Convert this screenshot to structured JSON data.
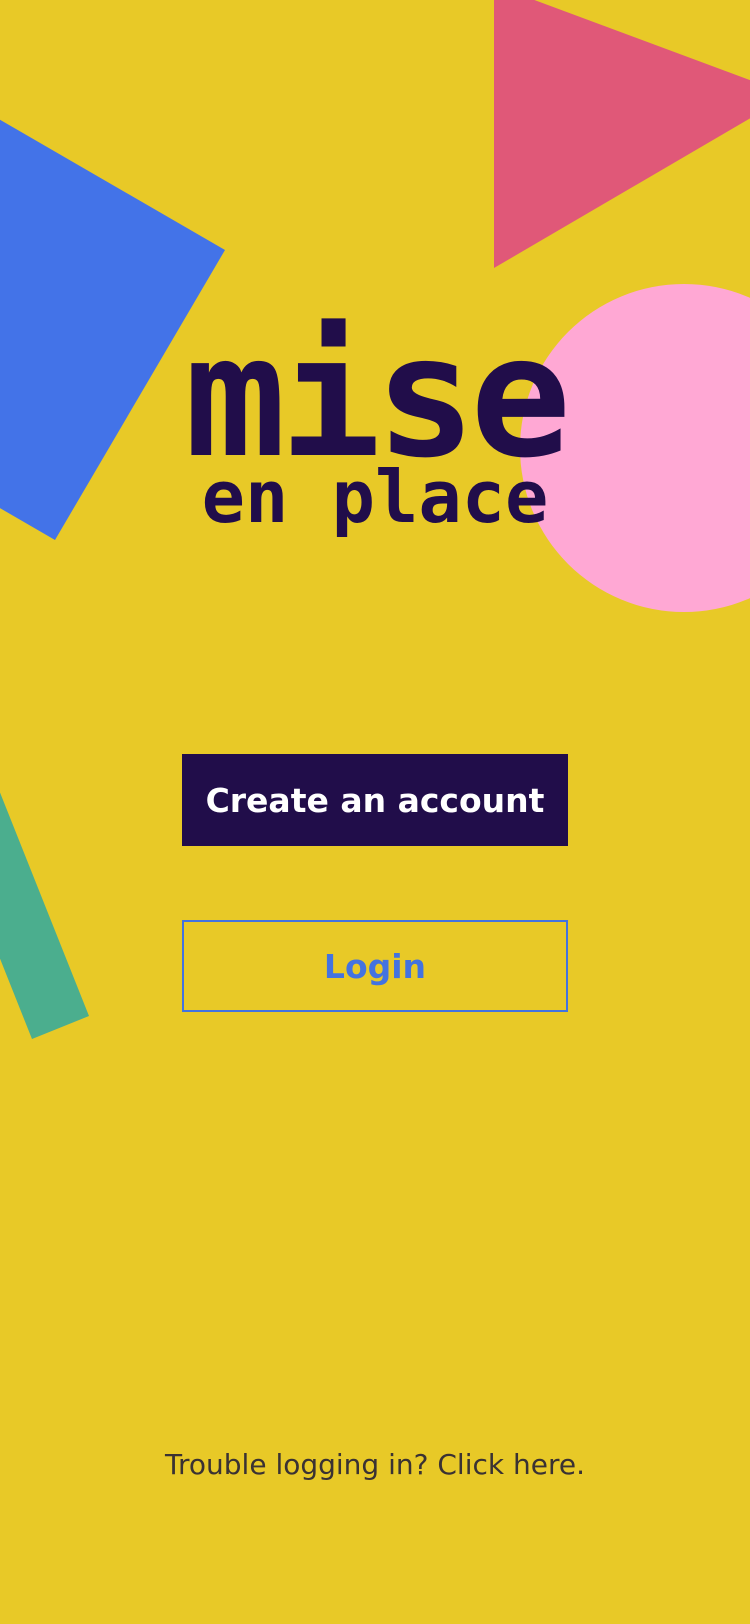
{
  "app": {
    "logo_line1": "mise",
    "logo_line2": "en place"
  },
  "actions": {
    "create_account_label": "Create an account",
    "login_label": "Login"
  },
  "footer": {
    "trouble_link": "Trouble logging in? Click here."
  },
  "colors": {
    "background": "#E8C927",
    "brand_dark": "#210D4A",
    "accent_blue": "#4373E0",
    "shape_blue": "#4373E8",
    "shape_red": "#E05878",
    "shape_pink": "#FFA8D4",
    "shape_green": "#4BAE8E"
  },
  "decorations": [
    "blue-square-shape",
    "red-triangle-shape",
    "pink-circle-shape",
    "green-bar-shape"
  ]
}
